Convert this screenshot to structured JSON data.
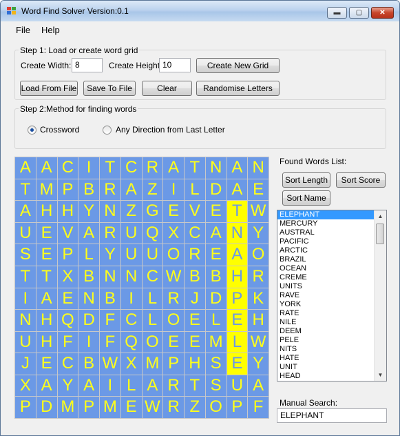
{
  "window": {
    "title": "Word Find Solver Version:0.1"
  },
  "titlebar_buttons": {
    "minimize": "▬",
    "maximize": "▢",
    "close": "✕"
  },
  "menu": [
    "File",
    "Help"
  ],
  "step1": {
    "label": "Step 1: Load or create word grid",
    "width_label": "Create Width:",
    "width_value": "8",
    "height_label": "Create Height:",
    "height_value": "10",
    "create_button": "Create New Grid",
    "load_button": "Load From File",
    "save_button": "Save To File",
    "clear_button": "Clear",
    "randomise_button": "Randomise Letters"
  },
  "step2": {
    "label": "Step 2:Method for finding words",
    "option_crossword": "Crossword",
    "option_any_direction": "Any Direction from Last Letter",
    "selected": "Crossword"
  },
  "grid": {
    "rows": [
      [
        "A",
        "A",
        "C",
        "I",
        "T",
        "C",
        "R",
        "A",
        "T",
        "N",
        "A",
        "N"
      ],
      [
        "T",
        "M",
        "P",
        "B",
        "R",
        "A",
        "Z",
        "I",
        "L",
        "D",
        "A",
        "E"
      ],
      [
        "A",
        "H",
        "H",
        "Y",
        "N",
        "Z",
        "G",
        "E",
        "V",
        "E",
        "T",
        "W"
      ],
      [
        "U",
        "E",
        "V",
        "A",
        "R",
        "U",
        "Q",
        "X",
        "C",
        "A",
        "N",
        "Y"
      ],
      [
        "S",
        "E",
        "P",
        "L",
        "Y",
        "U",
        "U",
        "O",
        "R",
        "E",
        "A",
        "O"
      ],
      [
        "T",
        "T",
        "X",
        "B",
        "N",
        "N",
        "C",
        "W",
        "B",
        "B",
        "H",
        "R"
      ],
      [
        "I",
        "A",
        "E",
        "N",
        "B",
        "I",
        "L",
        "R",
        "J",
        "D",
        "P",
        "K"
      ],
      [
        "N",
        "H",
        "Q",
        "D",
        "F",
        "C",
        "L",
        "O",
        "E",
        "L",
        "E",
        "H"
      ],
      [
        "U",
        "H",
        "F",
        "I",
        "F",
        "Q",
        "O",
        "E",
        "E",
        "M",
        "L",
        "W"
      ],
      [
        "J",
        "E",
        "C",
        "B",
        "W",
        "X",
        "M",
        "P",
        "H",
        "S",
        "E",
        "Y"
      ],
      [
        "X",
        "A",
        "Y",
        "A",
        "I",
        "L",
        "A",
        "R",
        "T",
        "S",
        "U",
        "A"
      ],
      [
        "P",
        "D",
        "M",
        "P",
        "M",
        "E",
        "W",
        "R",
        "Z",
        "O",
        "P",
        "F"
      ]
    ],
    "highlight": [
      [
        2,
        10
      ],
      [
        3,
        10
      ],
      [
        4,
        10
      ],
      [
        5,
        10
      ],
      [
        6,
        10
      ],
      [
        7,
        10
      ],
      [
        8,
        10
      ],
      [
        9,
        10
      ]
    ],
    "highlight_color": "#ffff00",
    "cell_color": "#6b99e6"
  },
  "found": {
    "label": "Found Words List:",
    "sort_length": "Sort Length",
    "sort_score": "Sort Score",
    "sort_name": "Sort Name",
    "words": [
      "ELEPHANT",
      "MERCURY",
      "AUSTRAL",
      "PACIFIC",
      "ARCTIC",
      "BRAZIL",
      "OCEAN",
      "CREME",
      "UNITS",
      "RAVE",
      "YORK",
      "RATE",
      "NILE",
      "DEEM",
      "PELE",
      "NITS",
      "HATE",
      "UNIT",
      "HEAD"
    ],
    "selected": "ELEPHANT"
  },
  "manual_search": {
    "label": "Manual Search:",
    "value": "ELEPHANT"
  }
}
